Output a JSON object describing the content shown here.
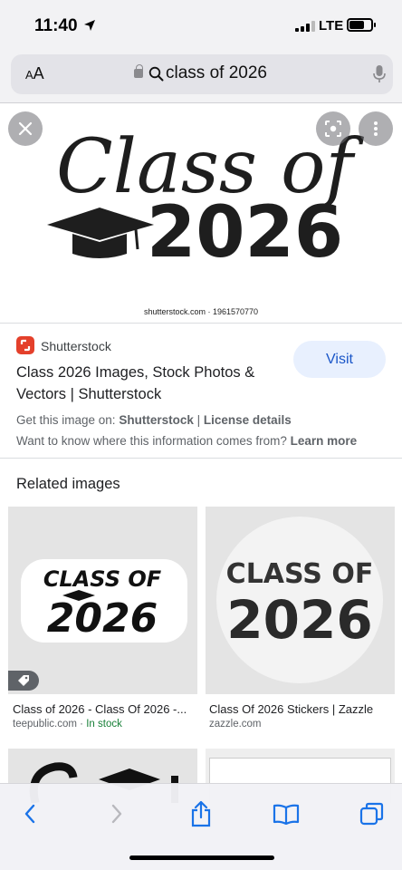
{
  "status_bar": {
    "time": "11:40",
    "network": "LTE",
    "icons": [
      "location-arrow-icon",
      "signal-icon",
      "battery-icon"
    ]
  },
  "address_bar": {
    "aa_label": "AA",
    "query": "class of 2026",
    "icons": [
      "lock-icon",
      "search-icon",
      "microphone-icon"
    ]
  },
  "hero": {
    "art_line1": "Class of",
    "art_line2": "2026",
    "credit": "shutterstock.com · 1961570770",
    "icons": [
      "close-icon",
      "lens-icon",
      "more-vert-icon"
    ]
  },
  "source": {
    "name": "Shutterstock",
    "title": "Class 2026 Images, Stock Photos & Vectors | Shutterstock",
    "visit_label": "Visit",
    "get_image_prefix": "Get this image on:",
    "get_image_site": "Shutterstock",
    "separator": "|",
    "license_label": "License details",
    "info_question": "Want to know where this information comes from?",
    "learn_more": "Learn more"
  },
  "related": {
    "heading": "Related images",
    "items": [
      {
        "art_line1": "CLASS OF",
        "art_line2": "2026",
        "caption": "Class of 2026 - Class Of 2026 -...",
        "site": "teepublic.com",
        "dot": "·",
        "availability": "In stock"
      },
      {
        "art_line1": "CLASS OF",
        "art_line2": "2026",
        "caption": "Class Of 2026 Stickers | Zazzle",
        "site": "zazzle.com"
      }
    ]
  },
  "toolbar": {
    "icons": [
      "back-icon",
      "forward-icon",
      "share-icon",
      "bookmarks-icon",
      "tabs-icon"
    ]
  },
  "colors": {
    "accent": "#1a56c8",
    "visit_bg": "#e8f0fe",
    "in_stock": "#188038",
    "shutterstock_red": "#e4402b"
  }
}
